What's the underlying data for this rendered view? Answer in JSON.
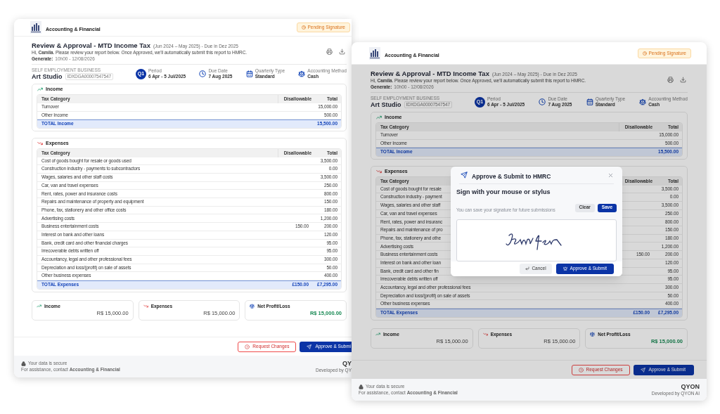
{
  "windows": [
    {
      "brand": "Accounting & Financial",
      "status": "Pending Signature",
      "title": "Review & Approval - MTD Income Tax",
      "title_note": "(Jun 2024 – May 2025) - Due in Dez 2025",
      "greeting": "Hi, **Camila**. Please review your report below. Once Approved, we'll automatically submit this report to HMRC.",
      "generated_label": "Generate:",
      "generated_value": "10h00 - 12/08/2026",
      "business": {
        "label": "SELF EMPLOYMENT BUSINESS",
        "name": "Art Studio",
        "id": "IDXDGA00007547547"
      },
      "meta": [
        {
          "kind": "quarter",
          "badge": "Q1",
          "label": "Period",
          "value": "6 Apr - 5 Jul/2025"
        },
        {
          "kind": "date",
          "label": "Due Date",
          "value": "7 Aug 2025"
        },
        {
          "kind": "type",
          "label": "Quarterly Type",
          "value": "Standard"
        },
        {
          "kind": "method",
          "label": "Accounting Method",
          "value": "Cash"
        }
      ],
      "sections": [
        {
          "kind": "income",
          "title": "Income",
          "columns": [
            "Tax Category",
            "Disallowable",
            "Total"
          ],
          "rows": [
            {
              "category": "Turnover",
              "total": "15,000.00"
            },
            {
              "category": "Other Income",
              "total": "500.00"
            }
          ],
          "total": {
            "label": "TOTAL Income",
            "total": "15,500.00"
          }
        },
        {
          "kind": "expenses",
          "title": "Expenses",
          "columns": [
            "Tax Category",
            "Disallowable",
            "Total"
          ],
          "rows": [
            {
              "category": "Cost of goods bought for resale or goods used",
              "total": "3,500.00"
            },
            {
              "category": "Construction industry - payments to subcontractors",
              "total": "0.00"
            },
            {
              "category": "Wages, salaries and other staff costs",
              "total": "3,500.00"
            },
            {
              "category": "Car, van and travel expenses",
              "total": "250.00"
            },
            {
              "category": "Rent, rates, power and insurance costs",
              "total": "800.00"
            },
            {
              "category": "Repairs and maintenance of property and equipment",
              "total": "150.00"
            },
            {
              "category": "Phone, fax, stationery and other office costs",
              "total": "180.00"
            },
            {
              "category": "Advertising costs",
              "total": "1,200.00"
            },
            {
              "category": "Business entertainment costs",
              "disallowable": "150.00",
              "total": "200.00"
            },
            {
              "category": "Interest on bank and other loans",
              "total": "120.00"
            },
            {
              "category": "Bank, credit card and other financial charges",
              "total": "95.00"
            },
            {
              "category": "Irrecoverable debts written off",
              "total": "95.00"
            },
            {
              "category": "Accountancy, legal and other professional fees",
              "total": "300.00"
            },
            {
              "category": "Depreciation and loss/(profit) on sale of assets",
              "total": "50.00"
            },
            {
              "category": "Other business expenses",
              "total": "400.00"
            }
          ],
          "total": {
            "label": "TOTAL Expenses",
            "disallowable": "£150.00",
            "total": "£7,295.00"
          }
        }
      ],
      "summary": [
        {
          "kind": "income",
          "label": "Income",
          "amount": "R$ 15,000.00"
        },
        {
          "kind": "expenses",
          "label": "Expenses",
          "amount": "R$ 15,000.00"
        },
        {
          "kind": "net",
          "label": "Net Profit/Loss",
          "amount": "R$ 15,000.00"
        }
      ],
      "actions": [
        {
          "kind": "secondary",
          "label": "Request Changes"
        },
        {
          "kind": "primary",
          "label": "Approve & Submi"
        }
      ],
      "footer": {
        "secure": "Your data is secure",
        "assistance": "For assistance, contact **Accounting & Financial**",
        "brand": "QY",
        "developed": "Developed by QY"
      }
    },
    {
      "brand": "Accounting & Financial",
      "status": "Pending Signature",
      "title": "Review & Approval - MTD Income Tax",
      "title_note": "(Jun 2024 – May 2025) - Due in Dez 2025",
      "greeting": "Hi, **Camila**. Please review your report below. Once Approved, we'll automatically submit this report to HMRC.",
      "generated_label": "Generate:",
      "generated_value": "10h00 - 12/08/2026",
      "business": {
        "label": "SELF EMPLOYMENT BUSINESS",
        "name": "Art Studio",
        "id": "IDXDGA00007547547"
      },
      "meta": [
        {
          "kind": "quarter",
          "badge": "Q1",
          "label": "Period",
          "value": "6 Apr - 5 Jul/2025"
        },
        {
          "kind": "date",
          "label": "Due Date",
          "value": "7 Aug 2025"
        },
        {
          "kind": "type",
          "label": "Quarterly Type",
          "value": "Standard"
        },
        {
          "kind": "method",
          "label": "Accounting Method",
          "value": "Cash"
        }
      ],
      "sections": [
        {
          "kind": "income",
          "title": "Income",
          "columns": [
            "Tax Category",
            "Disallowable",
            "Total"
          ],
          "rows": [
            {
              "category": "Turnover",
              "total": "15,000.00"
            },
            {
              "category": "Other Income",
              "total": "500.00"
            }
          ],
          "total": {
            "label": "TOTAL Income",
            "total": "15,500.00"
          }
        },
        {
          "kind": "expenses",
          "title": "Expenses",
          "columns": [
            "Tax Category",
            "Disallowable",
            "Total"
          ],
          "rows": [
            {
              "category": "Cost of goods bought for resale",
              "total": "3,500.00"
            },
            {
              "category": "Construction industry - payment",
              "total": "0.00"
            },
            {
              "category": "Wages, salaries and other staff",
              "total": "3,500.00"
            },
            {
              "category": "Car, van and travel expenses",
              "total": "250.00"
            },
            {
              "category": "Rent, rates, power and insuranc",
              "total": "800.00"
            },
            {
              "category": "Repairs and maintenance of pro",
              "total": "150.00"
            },
            {
              "category": "Phone, fax, stationery and othe",
              "total": "180.00"
            },
            {
              "category": "Advertising costs",
              "total": "1,200.00"
            },
            {
              "category": "Business entertainment costs",
              "disallowable": "150.00",
              "total": "200.00"
            },
            {
              "category": "Interest on bank and other loan",
              "total": "120.00"
            },
            {
              "category": "Bank, credit card and other fin",
              "total": "95.00"
            },
            {
              "category": "Irrecoverable debts written off",
              "total": "95.00"
            },
            {
              "category": "Accountancy, legal and other professional fees",
              "total": "300.00"
            },
            {
              "category": "Depreciation and loss/(profit) on sale of assets",
              "total": "50.00"
            },
            {
              "category": "Other business expenses",
              "total": "400.00"
            }
          ],
          "total": {
            "label": "TOTAL Expenses",
            "disallowable": "£150.00",
            "total": "£7,295.00"
          }
        }
      ],
      "summary": [
        {
          "kind": "income",
          "label": "Income",
          "amount": "R$ 15,000.00"
        },
        {
          "kind": "expenses",
          "label": "Expenses",
          "amount": "R$ 15,000.00"
        },
        {
          "kind": "net",
          "label": "Net Profit/Loss",
          "amount": "R$ 15,000.00"
        }
      ],
      "actions": [
        {
          "kind": "secondary",
          "label": "Request Changes"
        },
        {
          "kind": "primary",
          "label": "Approve & Submit"
        }
      ],
      "footer": {
        "secure": "Your data is secure",
        "assistance": "For assistance, contact **Accounting & Financial**",
        "brand": "QYON",
        "developed": "Developed by QYON AI"
      },
      "modal": {
        "title": "Approve & Submit to HMRC",
        "heading": "Sign with your mouse or stylus",
        "hint": "You can save your signature for future submissions",
        "buttons": [
          {
            "kind": "secondary",
            "label": "Clear"
          },
          {
            "kind": "primary",
            "label": "Save"
          }
        ],
        "actions": [
          {
            "kind": "cancel",
            "label": "Cancel"
          },
          {
            "kind": "submit",
            "label": "Approve & Submit"
          }
        ]
      }
    }
  ]
}
